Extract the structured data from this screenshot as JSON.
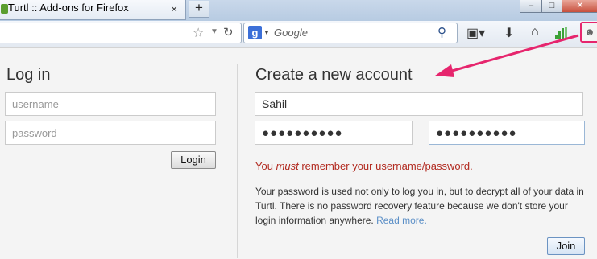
{
  "browser": {
    "tab_title": "Turtl :: Add-ons for Firefox",
    "tab_close": "×",
    "new_tab": "+",
    "window_buttons": [
      "–",
      "□",
      "✕"
    ],
    "search_engine_letter": "g",
    "search_placeholder": "Google"
  },
  "toolbar_icons": [
    "star-icon",
    "dropdown-icon",
    "reload-icon",
    "bookmarks-icon",
    "download-icon",
    "home-icon",
    "signal-icon",
    "turtl-icon"
  ],
  "login": {
    "heading": "Log in",
    "username_placeholder": "username",
    "password_placeholder": "password",
    "button": "Login"
  },
  "signup": {
    "heading": "Create a new account",
    "username_value": "Sahil",
    "password_value": "●●●●●●●●●●",
    "confirm_value": "●●●●●●●●●●",
    "warning_before": "You ",
    "warning_emphasis": "must",
    "warning_after": " remember your username/password.",
    "info_text": "Your password is used not only to log you in, but to decrypt all of your data in Turtl. There is no password recovery feature because we don't store your login information anywhere. ",
    "read_more": "Read more.",
    "button": "Join"
  },
  "colors": {
    "highlight": "#e6256d",
    "warning": "#b22a20",
    "link": "#5b8fc7"
  }
}
